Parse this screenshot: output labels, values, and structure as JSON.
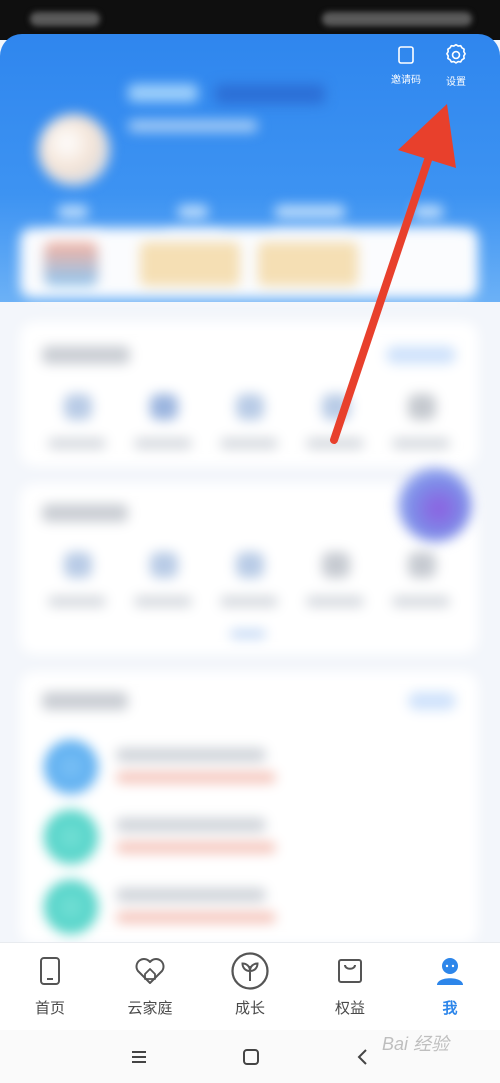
{
  "header": {
    "invite_label": "邀请码",
    "settings_label": "设置"
  },
  "bottom_nav": {
    "items": [
      {
        "label": "首页",
        "icon": "phone-icon"
      },
      {
        "label": "云家庭",
        "icon": "heart-home-icon"
      },
      {
        "label": "成长",
        "icon": "sprout-icon"
      },
      {
        "label": "权益",
        "icon": "bag-icon"
      },
      {
        "label": "我",
        "icon": "user-icon",
        "active": true
      }
    ]
  },
  "watermark": "Bai 经验",
  "colors": {
    "accent": "#2d86ea",
    "header": "#3d93f2",
    "arrow": "#e8402c"
  }
}
